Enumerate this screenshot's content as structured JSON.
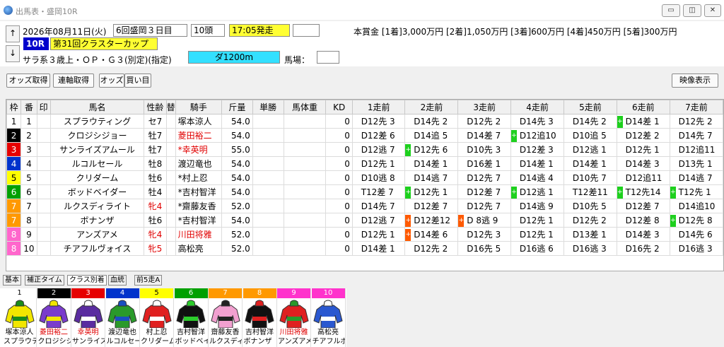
{
  "window": {
    "title": "出馬表・盛岡10R",
    "btn_min": "▭",
    "btn_max": "◫",
    "btn_close": "✕"
  },
  "race": {
    "date": "2026年08月11日(火)",
    "meet": "6回盛岡３日目",
    "heads": "10頭",
    "post_time": "17:05発走",
    "race_no": "10R",
    "race_name": "第31回クラスターカップ",
    "conditions": "サラ系３歳上・ＯＰ・Ｇ３(別定)(指定)",
    "course": "ダ1200m",
    "going_label": "馬場：",
    "prize": "本賞金 [1着]3,000万円 [2着]1,050万円 [3着]600万円 [4着]450万円 [5着]300万円",
    "up": "↑",
    "down": "↓"
  },
  "toolbar": {
    "odds_get": "オッズ取得",
    "renpuku_get": "連軸取得",
    "odds": "オッズ",
    "buy": "買い目",
    "video": "映像表示"
  },
  "columns": [
    "枠",
    "番",
    "印",
    "馬名",
    "性齢",
    "替",
    "騎手",
    "斤量",
    "単勝",
    "馬体重",
    "KD",
    "1走前",
    "2走前",
    "3走前",
    "4走前",
    "5走前",
    "6走前",
    "7走前"
  ],
  "frame_colors": {
    "1": "#ffffff",
    "2": "#000000",
    "3": "#e60000",
    "4": "#0033cc",
    "5": "#ffff00",
    "6": "#00a000",
    "7": "#ff9900",
    "8": "#ff66cc"
  },
  "frame_text": {
    "1": "#000000",
    "2": "#ffffff",
    "3": "#ffffff",
    "4": "#ffffff",
    "5": "#000000",
    "6": "#ffffff",
    "7": "#ffffff",
    "8": "#ffffff"
  },
  "horses": [
    {
      "waku": "1",
      "num": "1",
      "mark": "",
      "name": "スプラウティング",
      "age": "セ7",
      "age_red": false,
      "jockey": "塚本涼人",
      "jockey_red": false,
      "weight": "54.0",
      "kd": "0",
      "past": [
        [
          "",
          "D12先 3"
        ],
        [
          "",
          "D14先 2"
        ],
        [
          "",
          "D12先 2"
        ],
        [
          "",
          "D14先 3"
        ],
        [
          "",
          "D14先 2"
        ],
        [
          "g",
          "D14差 1"
        ],
        [
          "",
          "D12先 2"
        ]
      ]
    },
    {
      "waku": "2",
      "num": "2",
      "mark": "",
      "name": "クロジシジョー",
      "age": "牡7",
      "age_red": false,
      "jockey": "菱田裕二",
      "jockey_red": true,
      "weight": "54.0",
      "kd": "0",
      "past": [
        [
          "",
          "D12差 6"
        ],
        [
          "",
          "D14追 5"
        ],
        [
          "",
          "D14差 7"
        ],
        [
          "g",
          "D12追10"
        ],
        [
          "",
          "D10追 5"
        ],
        [
          "",
          "D12差 2"
        ],
        [
          "",
          "D14先 7"
        ]
      ]
    },
    {
      "waku": "3",
      "num": "3",
      "mark": "",
      "name": "サンライズアムール",
      "age": "牡7",
      "age_red": false,
      "jockey": "*幸英明",
      "jockey_red": true,
      "weight": "55.0",
      "kd": "0",
      "past": [
        [
          "",
          "D12逃 7"
        ],
        [
          "g",
          "D12先 6"
        ],
        [
          "",
          "D10先 3"
        ],
        [
          "",
          "D12差 3"
        ],
        [
          "",
          "D12逃 1"
        ],
        [
          "",
          "D12先 1"
        ],
        [
          "",
          "D12追11"
        ]
      ]
    },
    {
      "waku": "4",
      "num": "4",
      "mark": "",
      "name": "ルコルセール",
      "age": "牡8",
      "age_red": false,
      "jockey": "渡辺竜也",
      "jockey_red": false,
      "weight": "54.0",
      "kd": "0",
      "past": [
        [
          "",
          "D12先 1"
        ],
        [
          "",
          "D14差 1"
        ],
        [
          "",
          "D16差 1"
        ],
        [
          "",
          "D14差 1"
        ],
        [
          "",
          "D14差 1"
        ],
        [
          "",
          "D14差 3"
        ],
        [
          "",
          "D13先 1"
        ]
      ]
    },
    {
      "waku": "5",
      "num": "5",
      "mark": "",
      "name": "クリダーム",
      "age": "牡6",
      "age_red": false,
      "jockey": "*村上忍",
      "jockey_red": false,
      "weight": "54.0",
      "kd": "0",
      "past": [
        [
          "",
          "D10逃 8"
        ],
        [
          "",
          "D14逃 7"
        ],
        [
          "",
          "D12先 7"
        ],
        [
          "",
          "D14逃 4"
        ],
        [
          "",
          "D10先 7"
        ],
        [
          "",
          "D12追11"
        ],
        [
          "",
          "D14逃 7"
        ]
      ]
    },
    {
      "waku": "6",
      "num": "6",
      "mark": "",
      "name": "ボッドベイダー",
      "age": "牡4",
      "age_red": false,
      "jockey": "*吉村智洋",
      "jockey_red": false,
      "weight": "54.0",
      "kd": "0",
      "past": [
        [
          "",
          "T12差 7"
        ],
        [
          "g",
          "D12先 1"
        ],
        [
          "",
          "D12差 7"
        ],
        [
          "g",
          "D12逃 1"
        ],
        [
          "",
          "T12差11"
        ],
        [
          "g",
          "T12先14"
        ],
        [
          "g",
          "T12先 1"
        ]
      ]
    },
    {
      "waku": "7",
      "num": "7",
      "mark": "",
      "name": "ルクスディライト",
      "age": "牝4",
      "age_red": true,
      "jockey": "*齋藤友香",
      "jockey_red": false,
      "weight": "52.0",
      "kd": "0",
      "past": [
        [
          "",
          "D14先 7"
        ],
        [
          "",
          "D12差 7"
        ],
        [
          "",
          "D12先 7"
        ],
        [
          "",
          "D14逃 9"
        ],
        [
          "",
          "D10先 5"
        ],
        [
          "",
          "D12差 7"
        ],
        [
          "",
          "D14追10"
        ]
      ]
    },
    {
      "waku": "7",
      "num": "8",
      "mark": "",
      "name": "ボナンザ",
      "age": "牡6",
      "age_red": false,
      "jockey": "*吉村智洋",
      "jockey_red": false,
      "weight": "54.0",
      "kd": "0",
      "past": [
        [
          "",
          "D12逃 7"
        ],
        [
          "o",
          "D12差12"
        ],
        [
          "o",
          "D 8逃 9"
        ],
        [
          "",
          "D12先 1"
        ],
        [
          "",
          "D12先 2"
        ],
        [
          "",
          "D12差 8"
        ],
        [
          "g",
          "D12先 8"
        ]
      ]
    },
    {
      "waku": "8",
      "num": "9",
      "mark": "",
      "name": "アンズアメ",
      "age": "牝4",
      "age_red": true,
      "jockey": "川田将雅",
      "jockey_red": true,
      "weight": "52.0",
      "kd": "0",
      "past": [
        [
          "",
          "D12先 1"
        ],
        [
          "o",
          "D14差 6"
        ],
        [
          "",
          "D12先 3"
        ],
        [
          "",
          "D12先 1"
        ],
        [
          "",
          "D13差 1"
        ],
        [
          "",
          "D14差 3"
        ],
        [
          "",
          "D14先 6"
        ]
      ]
    },
    {
      "waku": "8",
      "num": "10",
      "mark": "",
      "name": "チアフルヴォイス",
      "age": "牝5",
      "age_red": true,
      "jockey": "高松亮",
      "jockey_red": false,
      "weight": "52.0",
      "kd": "0",
      "past": [
        [
          "",
          "D14差 1"
        ],
        [
          "",
          "D12先 2"
        ],
        [
          "",
          "D16先 5"
        ],
        [
          "",
          "D16逃 6"
        ],
        [
          "",
          "D16逃 3"
        ],
        [
          "",
          "D16先 2"
        ],
        [
          "",
          "D16逃 3"
        ]
      ]
    }
  ],
  "tabs": [
    "基本",
    "補正タイム",
    "クラス別着",
    "血統",
    "前5走A"
  ],
  "silks": [
    {
      "num": "1",
      "jockey": "塚本涼人",
      "horse": "スプラウティング",
      "bg": "#ffffff",
      "fg": "#000",
      "c1": "#f2e600",
      "c2": "#1a8c1a"
    },
    {
      "num": "2",
      "jockey": "菱田裕二",
      "horse": "クロジシジョー",
      "bg": "#000000",
      "fg": "#fff",
      "c1": "#7a3ccc",
      "c2": "#f2e600"
    },
    {
      "num": "3",
      "jockey": "幸英明",
      "horse": "サンライズアムール",
      "bg": "#e60000",
      "fg": "#fff",
      "c1": "#5a2ca0",
      "c2": "#ffffff"
    },
    {
      "num": "4",
      "jockey": "渡辺竜也",
      "horse": "ルコルセール",
      "bg": "#0033cc",
      "fg": "#fff",
      "c1": "#2a9a2a",
      "c2": "#1a4fc0"
    },
    {
      "num": "5",
      "jockey": "村上忍",
      "horse": "クリダーム",
      "bg": "#ffff00",
      "fg": "#000",
      "c1": "#e02020",
      "c2": "#ffffff"
    },
    {
      "num": "6",
      "jockey": "吉村智洋",
      "horse": "ボッドベイダー",
      "bg": "#00a000",
      "fg": "#fff",
      "c1": "#111111",
      "c2": "#2ccc2c"
    },
    {
      "num": "7",
      "jockey": "齋藤友香",
      "horse": "ルクスディライト",
      "bg": "#ff9900",
      "fg": "#fff",
      "c1": "#f2a0d0",
      "c2": "#222222"
    },
    {
      "num": "8",
      "jockey": "吉村智洋",
      "horse": "ボナンザ",
      "bg": "#ff9900",
      "fg": "#fff",
      "c1": "#111111",
      "c2": "#e02020"
    },
    {
      "num": "9",
      "jockey": "川田将雅",
      "horse": "アンズアメ",
      "bg": "#ff33cc",
      "fg": "#fff",
      "c1": "#e02020",
      "c2": "#2a9a2a"
    },
    {
      "num": "10",
      "jockey": "高松亮",
      "horse": "チアフルボイス",
      "bg": "#ff33cc",
      "fg": "#fff",
      "c1": "#2a58d0",
      "c2": "#ffffff"
    }
  ]
}
